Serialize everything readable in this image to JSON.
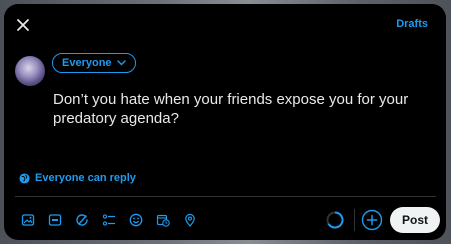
{
  "header": {
    "drafts_label": "Drafts"
  },
  "composer": {
    "audience_label": "Everyone",
    "text": "Don’t you hate when your friends expose you for your predatory agenda?",
    "reply_setting_label": "Everyone can reply",
    "post_label": "Post"
  },
  "toolbar": {
    "icons": [
      "media-icon",
      "gif-icon",
      "grok-icon",
      "poll-icon",
      "emoji-icon",
      "schedule-icon",
      "location-icon"
    ]
  },
  "colors": {
    "accent": "#1d9bf0",
    "background": "#000000",
    "text": "#e7e9ea",
    "post_button": "#eff3f4"
  }
}
